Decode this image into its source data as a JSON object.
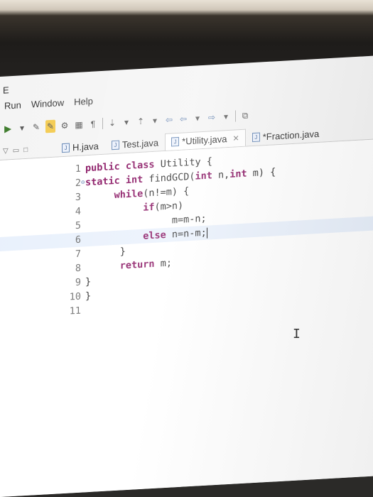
{
  "title_fragment": "E",
  "menu": [
    "Run",
    "Window",
    "Help"
  ],
  "tabs": [
    {
      "label": "H.java",
      "icon": "java-file-icon",
      "active": false
    },
    {
      "label": "Test.java",
      "icon": "java-file-icon",
      "active": false
    },
    {
      "label": "*Utility.java",
      "icon": "java-file-icon",
      "active": true
    },
    {
      "label": "*Fraction.java",
      "icon": "java-file-icon",
      "active": false
    }
  ],
  "code_lines": [
    {
      "num": "1",
      "fold": false,
      "indent": "",
      "tokens": [
        {
          "t": "public",
          "kw": true
        },
        {
          "t": " "
        },
        {
          "t": "class",
          "kw": true
        },
        {
          "t": " Utility {"
        }
      ]
    },
    {
      "num": "2",
      "fold": true,
      "indent": "",
      "tokens": [
        {
          "t": "static",
          "kw": true
        },
        {
          "t": " "
        },
        {
          "t": "int",
          "kw": true
        },
        {
          "t": " findGCD("
        },
        {
          "t": "int",
          "kw": true
        },
        {
          "t": " n,"
        },
        {
          "t": "int",
          "kw": true
        },
        {
          "t": " m) {"
        }
      ]
    },
    {
      "num": "3",
      "fold": false,
      "indent": "     ",
      "tokens": [
        {
          "t": "while",
          "kw": true
        },
        {
          "t": "(n!=m) {"
        }
      ]
    },
    {
      "num": "4",
      "fold": false,
      "indent": "          ",
      "tokens": [
        {
          "t": "if",
          "kw": true
        },
        {
          "t": "(m>n)"
        }
      ]
    },
    {
      "num": "5",
      "fold": false,
      "indent": "               ",
      "tokens": [
        {
          "t": "m=m-n;"
        }
      ]
    },
    {
      "num": "6",
      "fold": false,
      "indent": "          ",
      "tokens": [
        {
          "t": "else",
          "kw": true
        },
        {
          "t": " n=n-m;"
        }
      ],
      "current": true
    },
    {
      "num": "7",
      "fold": false,
      "indent": "      ",
      "tokens": [
        {
          "t": "}"
        }
      ]
    },
    {
      "num": "8",
      "fold": false,
      "indent": "      ",
      "tokens": [
        {
          "t": "return",
          "kw": true
        },
        {
          "t": " m;"
        }
      ]
    },
    {
      "num": "9",
      "fold": false,
      "indent": "",
      "tokens": [
        {
          "t": "}"
        }
      ]
    },
    {
      "num": "10",
      "fold": false,
      "indent": "",
      "tokens": [
        {
          "t": "}"
        }
      ]
    },
    {
      "num": "11",
      "fold": false,
      "indent": "",
      "tokens": []
    }
  ],
  "colors": {
    "keyword": "#7f0055",
    "current_line": "#e8f0fc"
  }
}
